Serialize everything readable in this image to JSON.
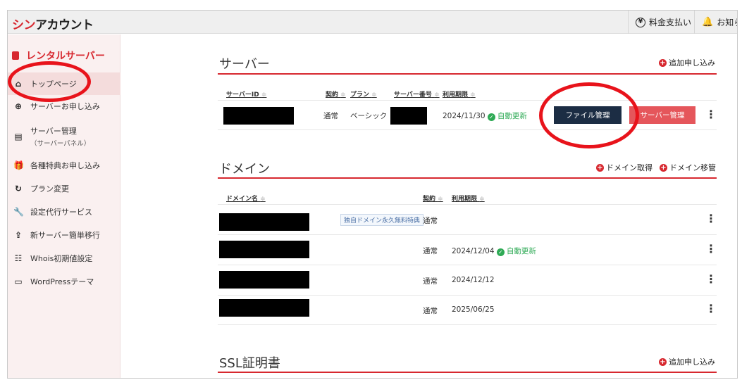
{
  "header": {
    "logo_red": "シン",
    "logo_dark": "アカウント",
    "payment_label": "料金支払い",
    "notice_label": "お知ら",
    "yen_symbol": "¥",
    "bell_symbol": "🔔"
  },
  "sidebar": {
    "title": "レンタルサーバー",
    "items": [
      {
        "icon": "⌂",
        "label": "トップページ",
        "sub": ""
      },
      {
        "icon": "⊕",
        "label": "サーバーお申し込み",
        "sub": ""
      },
      {
        "icon": "▤",
        "label": "サーバー管理",
        "sub": "（サーバーパネル）"
      },
      {
        "icon": "🎁",
        "label": "各種特典お申し込み",
        "sub": ""
      },
      {
        "icon": "↻",
        "label": "プラン変更",
        "sub": ""
      },
      {
        "icon": "🔧",
        "label": "設定代行サービス",
        "sub": ""
      },
      {
        "icon": "⇪",
        "label": "新サーバー簡単移行",
        "sub": ""
      },
      {
        "icon": "☷",
        "label": "Whois初期値設定",
        "sub": ""
      },
      {
        "icon": "▭",
        "label": "WordPressテーマ",
        "sub": ""
      }
    ]
  },
  "server": {
    "title": "サーバー",
    "add_link": "追加申し込み",
    "columns": {
      "id": "サーバーID",
      "contract": "契約",
      "plan": "プラン",
      "number": "サーバー番号",
      "expiry": "利用期限"
    },
    "row": {
      "contract": "通常",
      "plan": "ベーシック",
      "expiry": "2024/11/30",
      "auto_renew": "自動更新",
      "file_button": "ファイル管理",
      "server_button": "サーバー管理"
    }
  },
  "domain": {
    "title": "ドメイン",
    "acquire_link": "ドメイン取得",
    "transfer_link": "ドメイン移管",
    "columns": {
      "name": "ドメイン名",
      "contract": "契約",
      "expiry": "利用期限"
    },
    "badge": "独自ドメイン永久無料特典",
    "rows": [
      {
        "contract": "通常",
        "expiry": "",
        "auto_renew": ""
      },
      {
        "contract": "通常",
        "expiry": "2024/12/04",
        "auto_renew": "自動更新"
      },
      {
        "contract": "通常",
        "expiry": "2024/12/12",
        "auto_renew": ""
      },
      {
        "contract": "通常",
        "expiry": "2025/06/25",
        "auto_renew": ""
      }
    ]
  },
  "ssl": {
    "title": "SSL証明書",
    "add_link": "追加申し込み"
  },
  "common": {
    "plus": "+",
    "check": "✓",
    "sort": "≑",
    "dots": "⋮"
  },
  "colors": {
    "brand_red": "#d7282f",
    "navy_button": "#1c2d44",
    "red_button": "#e5565b",
    "ok_green": "#2eaa55"
  }
}
